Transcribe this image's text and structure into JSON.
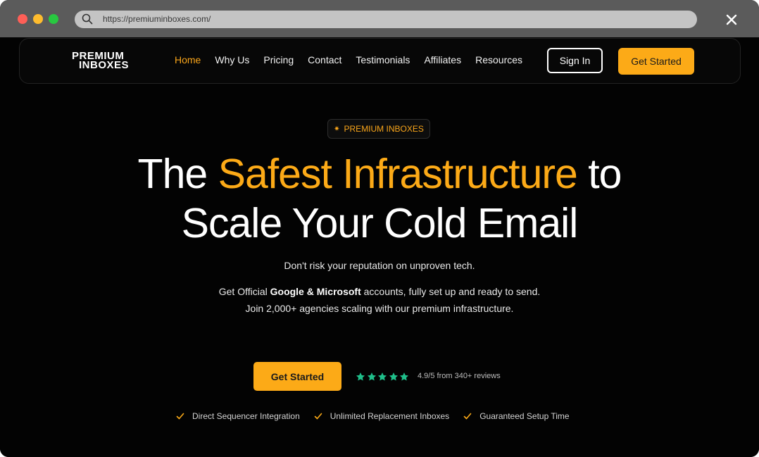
{
  "browser": {
    "url": "https://premiuminboxes.com/"
  },
  "nav": {
    "logo_line1": "PREMIUM",
    "logo_line2": "INBOXES",
    "links": [
      "Home",
      "Why Us",
      "Pricing",
      "Contact",
      "Testimonials",
      "Affiliates",
      "Resources"
    ],
    "active": "Home",
    "sign_in": "Sign In",
    "get_started": "Get Started"
  },
  "hero": {
    "badge": "PREMIUM INBOXES",
    "title_part1": "The ",
    "title_accent": "Safest Infrastructure",
    "title_part2": " to",
    "title_line2": "Scale Your Cold Email",
    "sub1": "Don't risk your reputation on unproven tech.",
    "sub2_pre": "Get Official ",
    "sub2_bold": "Google & Microsoft",
    "sub2_post": " accounts, fully set up and ready to send.",
    "sub3": "Join 2,000+ agencies scaling with our premium infrastructure.",
    "cta": "Get Started",
    "rating_text": "4.9/5 from 340+ reviews",
    "stars": 5,
    "features": [
      "Direct Sequencer Integration",
      "Unlimited Replacement Inboxes",
      "Guaranteed Setup Time"
    ]
  },
  "colors": {
    "accent": "#fcaa17",
    "star": "#1fbf8a",
    "background": "#030303"
  }
}
